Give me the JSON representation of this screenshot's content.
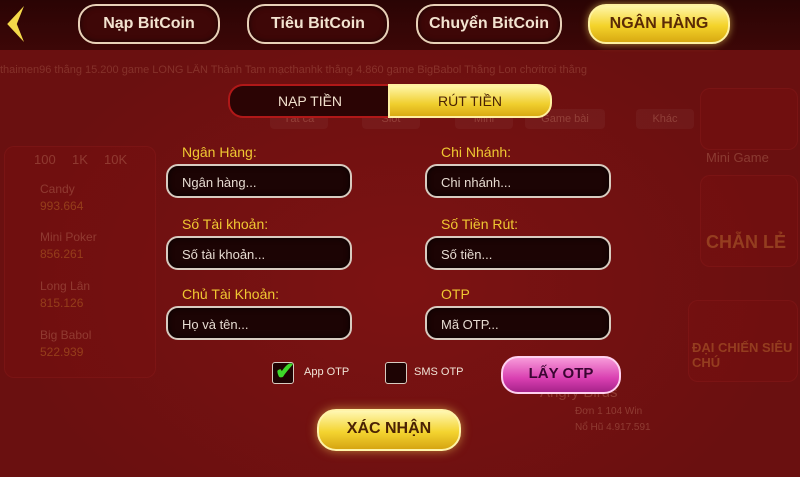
{
  "nav": {
    "buttons": [
      {
        "label": "Nạp BitCoin"
      },
      {
        "label": "Tiêu BitCoin"
      },
      {
        "label": "Chuyển BitCoin"
      },
      {
        "label": "NGÂN HÀNG"
      }
    ]
  },
  "tabs": {
    "deposit": "NẠP TIỀN",
    "withdraw": "RÚT TIỀN"
  },
  "form": {
    "bank": {
      "label": "Ngân Hàng:",
      "placeholder": "Ngân hàng..."
    },
    "branch": {
      "label": "Chi Nhánh:",
      "placeholder": "Chi nhánh..."
    },
    "account_number": {
      "label": "Số Tài khoản:",
      "placeholder": "Số tài khoản..."
    },
    "amount": {
      "label": "Số Tiền Rút:",
      "placeholder": "Số tiền..."
    },
    "account_holder": {
      "label": "Chủ Tài Khoản:",
      "placeholder": "Họ và tên..."
    },
    "otp": {
      "label": "OTP",
      "placeholder": "Mã OTP..."
    }
  },
  "otp_options": {
    "app_otp": {
      "label": "App OTP",
      "checked": true
    },
    "sms_otp": {
      "label": "SMS OTP",
      "checked": false
    },
    "get_otp_button": "LẤY OTP"
  },
  "confirm_button": "XÁC NHẬN",
  "background": {
    "ticker": "thaimen96 thắng 15.200 game LONG LÂN        Thành Tam mạcthanhk thắng 4.860 game BigBabol        Thắng Lon chơitroi thắng",
    "filters": [
      "100",
      "1K",
      "10K"
    ],
    "jackpots": [
      {
        "name": "Candy",
        "value": "993.664"
      },
      {
        "name": "Mini Poker",
        "value": "856.261"
      },
      {
        "name": "Long Lân",
        "value": "815.126"
      },
      {
        "name": "Big Babol",
        "value": "522.939"
      }
    ],
    "game_tabs": [
      "Tất cả",
      "Slot",
      "Mini",
      "Game bài",
      "Khác"
    ],
    "right_labels": [
      "Mini Game",
      "CHẴN LẺ",
      "ĐẠI CHIẾN SIÊU CHÚ"
    ],
    "bottom_game": {
      "name": "Angry Birds",
      "line1": "Đơn 1 104 Win",
      "line2": "Nổ Hũ 4.917.591"
    }
  },
  "colors": {
    "accent_gold": "#f0c832",
    "active_tab": "#f4d32a",
    "otp_button": "#d93fb1",
    "checkbox_tick": "#3ed92a"
  }
}
